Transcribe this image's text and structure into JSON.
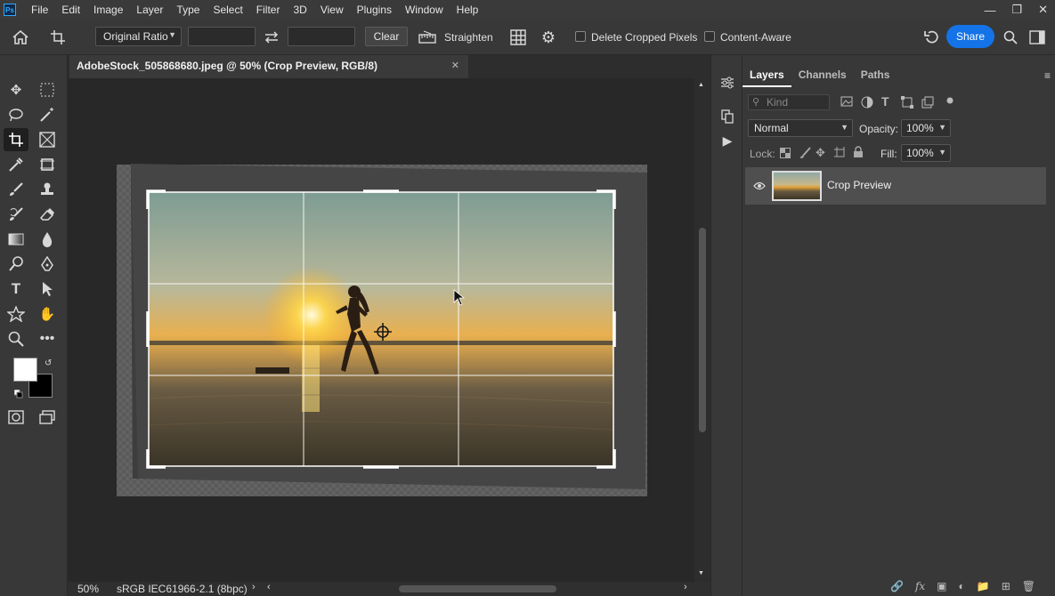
{
  "app": {
    "logo_text": "Ps"
  },
  "menu": [
    "File",
    "Edit",
    "Image",
    "Layer",
    "Type",
    "Select",
    "Filter",
    "3D",
    "View",
    "Plugins",
    "Window",
    "Help"
  ],
  "options_bar": {
    "ratio_value": "Original Ratio",
    "clear_label": "Clear",
    "straighten_label": "Straighten",
    "delete_cropped_label": "Delete Cropped Pixels",
    "content_aware_label": "Content-Aware",
    "share_label": "Share"
  },
  "document": {
    "tab_title": "AdobeStock_505868680.jpeg @ 50% (Crop Preview, RGB/8)",
    "zoom": "50%",
    "color_profile": "sRGB IEC61966-2.1 (8bpc)"
  },
  "layers_panel": {
    "tabs": [
      "Layers",
      "Channels",
      "Paths"
    ],
    "kind_placeholder": "Kind",
    "blend_mode": "Normal",
    "opacity_label": "Opacity:",
    "opacity_value": "100%",
    "lock_label": "Lock:",
    "fill_label": "Fill:",
    "fill_value": "100%",
    "layers": [
      {
        "name": "Crop Preview",
        "visible": true
      }
    ]
  },
  "colors": {
    "accent": "#1473e6",
    "foreground": "#ffffff",
    "background": "#000000"
  }
}
